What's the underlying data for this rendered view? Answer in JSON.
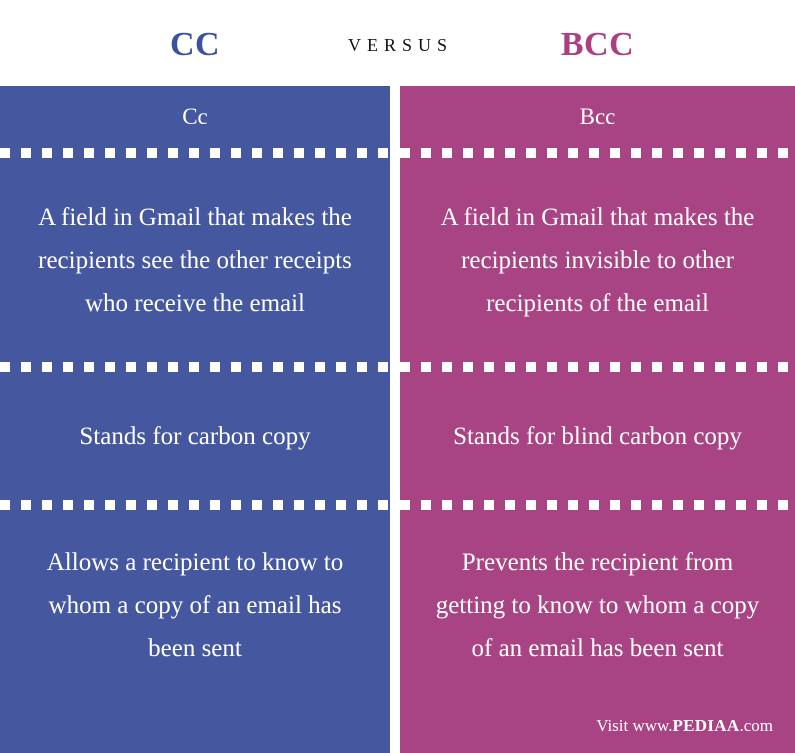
{
  "header": {
    "left_title": "CC",
    "versus": "VERSUS",
    "right_title": "BCC",
    "left_color": "#3a53a0",
    "right_color": "#ac3f7f",
    "versus_color": "#111111"
  },
  "colors": {
    "left_panel": "#45589f",
    "right_panel": "#a94484",
    "text": "#ffffff",
    "background": "#ffffff",
    "separator": "#ffffff"
  },
  "columns": [
    {
      "id": "cc",
      "label": "Cc",
      "accent": "#45589f",
      "rows": [
        "A field in Gmail that makes the recipients see the other receipts who receive the email",
        "Stands for carbon copy",
        "Allows a recipient to know to whom a copy of an email has been sent"
      ]
    },
    {
      "id": "bcc",
      "label": "Bcc",
      "accent": "#a94484",
      "rows": [
        "A field in Gmail that makes the recipients invisible to other recipients of the email",
        "Stands for blind carbon copy",
        "Prevents the recipient from getting to know to whom a copy of an email has been sent"
      ]
    }
  ],
  "footer": {
    "prefix": "Visit www.",
    "brand": "PEDIAA",
    "suffix": ".com"
  }
}
